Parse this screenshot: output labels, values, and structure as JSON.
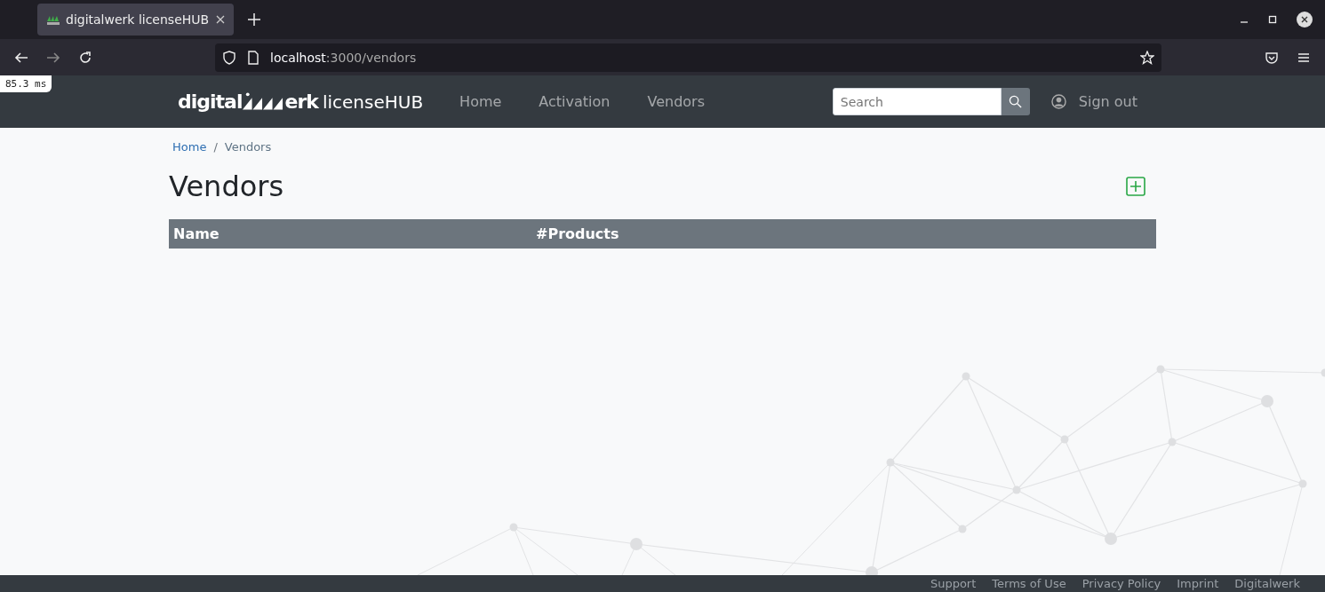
{
  "browser": {
    "tab": {
      "title": "digitalwerk licenseHUB"
    },
    "url": {
      "host": "localhost",
      "rest": ":3000/vendors"
    },
    "timing_badge": "85.3 ms"
  },
  "navbar": {
    "logo": {
      "prefix": "digital",
      "suffix": "erk",
      "product": "licenseHUB"
    },
    "links": [
      {
        "label": "Home"
      },
      {
        "label": "Activation"
      },
      {
        "label": "Vendors"
      }
    ],
    "search": {
      "placeholder": "Search"
    },
    "sign_out": "Sign out"
  },
  "breadcrumb_separator": "/",
  "breadcrumb": [
    {
      "label": "Home",
      "link": true
    },
    {
      "label": "Vendors",
      "link": false
    }
  ],
  "page_title": "Vendors",
  "table": {
    "columns": [
      "Name",
      "#Products"
    ]
  },
  "footer": {
    "links": [
      "Support",
      "Terms of Use",
      "Privacy Policy",
      "Imprint",
      "Digitalwerk"
    ]
  }
}
